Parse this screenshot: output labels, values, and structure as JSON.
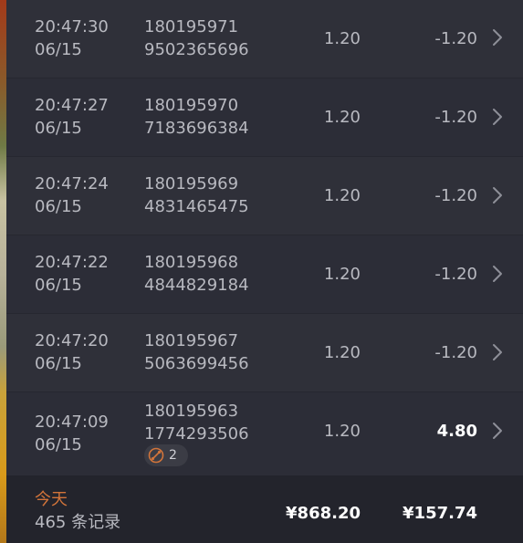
{
  "records": [
    {
      "time": "20:47:30",
      "date": "06/15",
      "id_line1": "180195971",
      "id_line2": "9502365696",
      "amount": "1.20",
      "change": "-1.20"
    },
    {
      "time": "20:47:27",
      "date": "06/15",
      "id_line1": "180195970",
      "id_line2": "7183696384",
      "amount": "1.20",
      "change": "-1.20"
    },
    {
      "time": "20:47:24",
      "date": "06/15",
      "id_line1": "180195969",
      "id_line2": "4831465475",
      "amount": "1.20",
      "change": "-1.20"
    },
    {
      "time": "20:47:22",
      "date": "06/15",
      "id_line1": "180195968",
      "id_line2": "4844829184",
      "amount": "1.20",
      "change": "-1.20"
    },
    {
      "time": "20:47:20",
      "date": "06/15",
      "id_line1": "180195967",
      "id_line2": "5063699456",
      "amount": "1.20",
      "change": "-1.20"
    },
    {
      "time": "20:47:09",
      "date": "06/15",
      "id_line1": "180195963",
      "id_line2": "1774293506",
      "amount": "1.20",
      "change": "4.80",
      "badge_count": "2",
      "badge_icon": "free-spin-icon"
    }
  ],
  "summary": {
    "day_label": "今天",
    "count_label": "465 条记录",
    "total_amount": "¥868.20",
    "total_change": "¥157.74"
  },
  "colors": {
    "background": "#2b2c36",
    "accent": "#d2743a",
    "text_muted": "#b8b9c0",
    "text_bright": "#ffffff"
  },
  "icons": {
    "row_arrow": "chevron-right-icon"
  }
}
